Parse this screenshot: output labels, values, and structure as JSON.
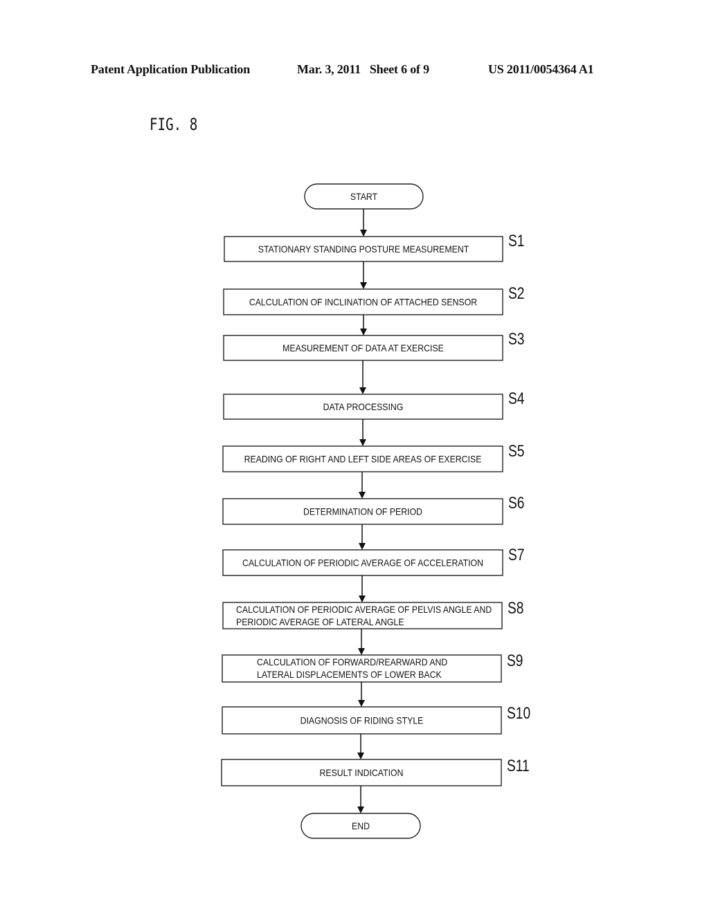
{
  "header": {
    "left": "Patent Application Publication",
    "middle": "Mar. 3, 2011   Sheet 6 of 9",
    "right": "US 2011/0054364 A1"
  },
  "figure_label": "FIG. 8",
  "flowchart": {
    "start": "START",
    "end": "END",
    "steps": [
      {
        "id": "S1",
        "lines": [
          "STATIONARY STANDING POSTURE MEASUREMENT"
        ]
      },
      {
        "id": "S2",
        "lines": [
          "CALCULATION OF INCLINATION OF ATTACHED SENSOR"
        ]
      },
      {
        "id": "S3",
        "lines": [
          "MEASUREMENT OF DATA AT EXERCISE"
        ]
      },
      {
        "id": "S4",
        "lines": [
          "DATA PROCESSING"
        ]
      },
      {
        "id": "S5",
        "lines": [
          "READING OF RIGHT AND LEFT SIDE AREAS OF EXERCISE"
        ]
      },
      {
        "id": "S6",
        "lines": [
          "DETERMINATION OF PERIOD"
        ]
      },
      {
        "id": "S7",
        "lines": [
          "CALCULATION OF PERIODIC AVERAGE OF ACCELERATION"
        ]
      },
      {
        "id": "S8",
        "lines": [
          "CALCULATION OF PERIODIC AVERAGE OF PELVIS ANGLE AND",
          "PERIODIC AVERAGE OF LATERAL ANGLE"
        ]
      },
      {
        "id": "S9",
        "lines": [
          "CALCULATION OF FORWARD/REARWARD AND",
          "LATERAL DISPLACEMENTS OF LOWER BACK"
        ]
      },
      {
        "id": "S10",
        "lines": [
          "DIAGNOSIS OF RIDING STYLE"
        ]
      },
      {
        "id": "S11",
        "lines": [
          "RESULT INDICATION"
        ]
      }
    ]
  }
}
